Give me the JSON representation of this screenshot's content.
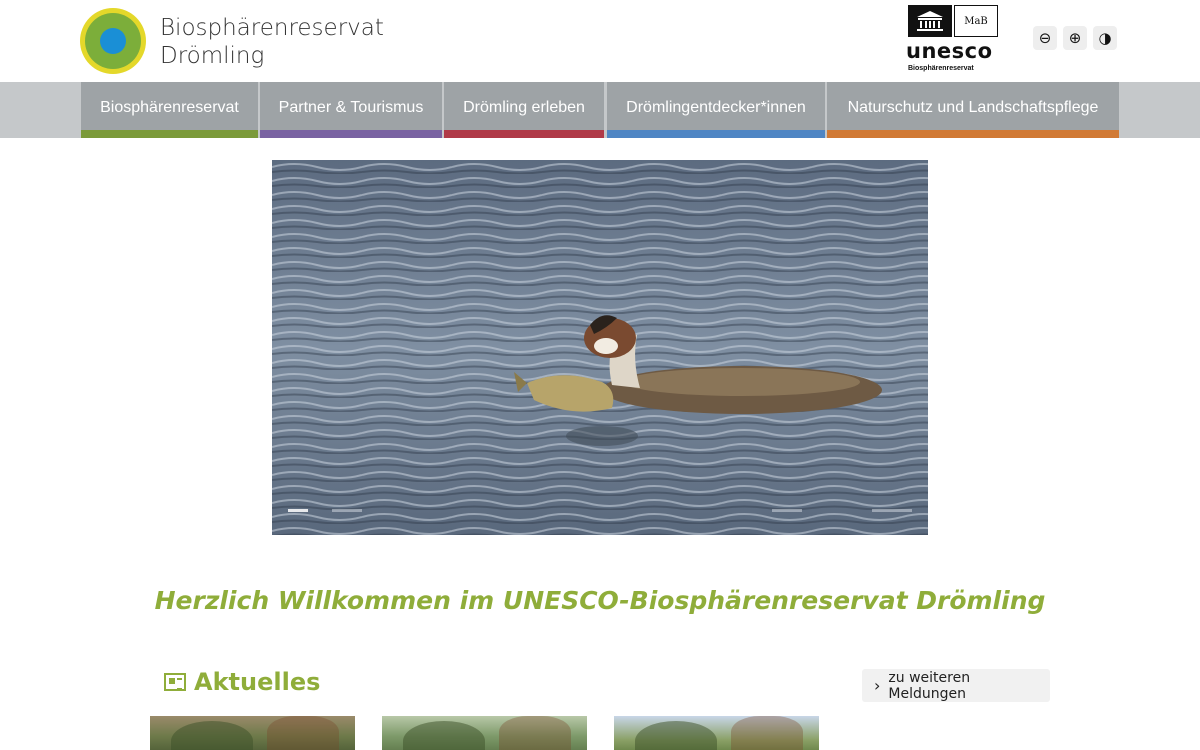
{
  "header": {
    "site_title_line1": "Biosphärenreservat",
    "site_title_line2": "Drömling",
    "unesco_word": "unesco",
    "unesco_sub": "Biosphärenreservat",
    "mab_label": "MaB",
    "a11y": {
      "decrease": "⊖",
      "increase": "⊕",
      "contrast": "◑"
    }
  },
  "nav": {
    "items": [
      {
        "label": "Biosphärenreservat",
        "color": "#7b9a3a"
      },
      {
        "label": "Partner & Tourismus",
        "color": "#7a63a2"
      },
      {
        "label": "Drömling erleben",
        "color": "#b03a48"
      },
      {
        "label": "Drömlingentdecker*innen",
        "color": "#4f86c4"
      },
      {
        "label": "Naturschutz und Landschaftspflege",
        "color": "#d17a35"
      }
    ]
  },
  "hero": {
    "subject": "great-crested-grebe-with-fish-on-water"
  },
  "welcome": {
    "text": "Herzlich Willkommen im UNESCO-Biosphärenreservat Drömling"
  },
  "news": {
    "title": "Aktuelles",
    "more_label": "zu weiteren Meldungen",
    "more_icon": "chevron-right-icon"
  },
  "colors": {
    "accent_green": "#8fad3a",
    "nav_gray": "#9ea3a6",
    "navbar_bg": "#c5c8ca"
  }
}
